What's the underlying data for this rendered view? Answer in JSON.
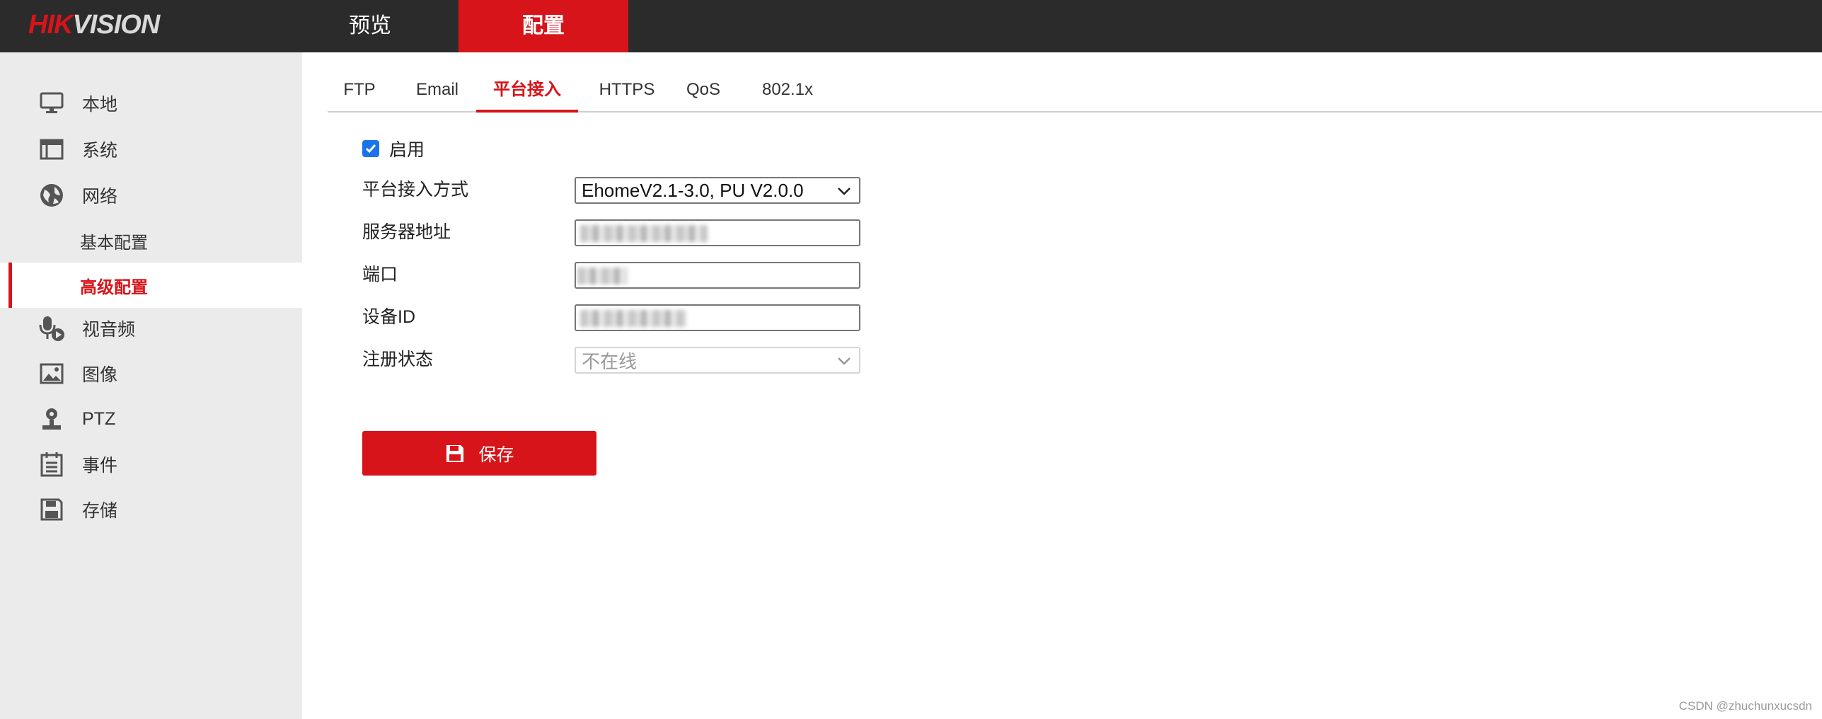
{
  "brand": {
    "part1": "HIK",
    "part2": "VISION"
  },
  "top_nav": {
    "preview": "预览",
    "config": "配置"
  },
  "sidebar": {
    "local": "本地",
    "system": "系统",
    "network": "网络",
    "basic_config": "基本配置",
    "advanced_config": "高级配置",
    "video_audio": "视音频",
    "image": "图像",
    "ptz": "PTZ",
    "event": "事件",
    "storage": "存储"
  },
  "tabs": [
    "FTP",
    "Email",
    "平台接入",
    "HTTPS",
    "QoS",
    "802.1x"
  ],
  "active_tab": "平台接入",
  "form": {
    "enable_label": "启用",
    "enable_checked": true,
    "access_mode_label": "平台接入方式",
    "access_mode_value": "EhomeV2.1-3.0, PU V2.0.0",
    "server_address_label": "服务器地址",
    "port_label": "端口",
    "device_id_label": "设备ID",
    "register_status_label": "注册状态",
    "register_status_value": "不在线"
  },
  "save_button": "保存",
  "watermark": "CSDN @zhuchunxucsdn",
  "colors": {
    "accent": "#d7141a",
    "topbar": "#2b2b2b",
    "sidebar": "#ebebeb",
    "checkbox": "#1a73e8"
  }
}
